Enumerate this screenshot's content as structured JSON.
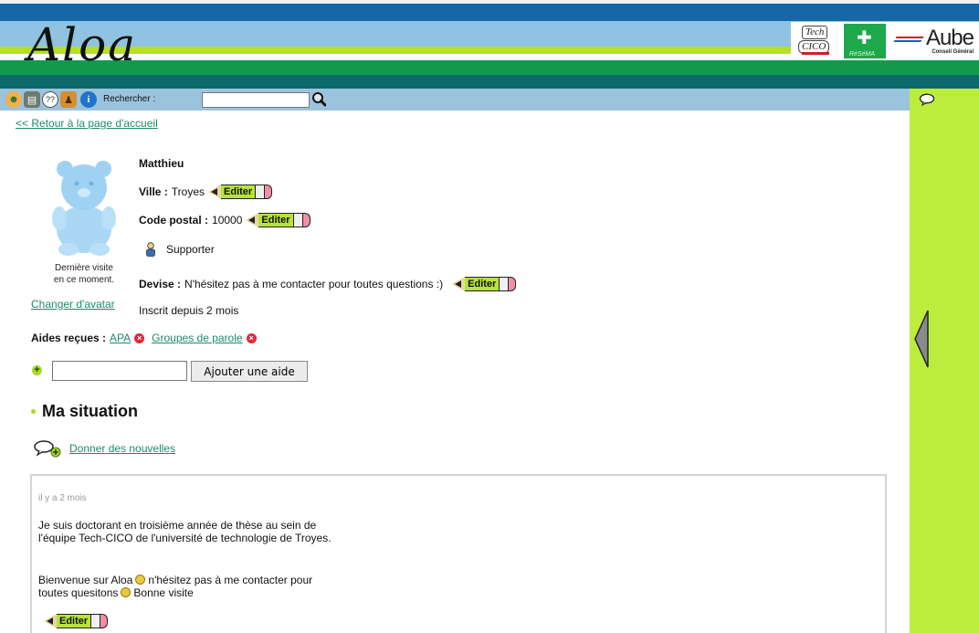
{
  "header": {
    "logo": "Aloa",
    "partners": {
      "techcico_top": "Tech",
      "techcico_bottom": "CICO",
      "resema": "RéSéMA",
      "aube_title": "Aube",
      "aube_subtitle": "Conseil Général"
    }
  },
  "toolbar": {
    "icons": [
      "users-icon",
      "book-icon",
      "chat-icon",
      "people-icon",
      "info-icon"
    ],
    "search_label": "Rechercher :",
    "search_value": ""
  },
  "nav": {
    "back_link": "<< Retour à la page d'accueil"
  },
  "profile": {
    "name": "Matthieu",
    "last_visit_line1": "Dernière visite",
    "last_visit_line2": "en ce moment.",
    "change_avatar": "Changer d'avatar",
    "ville_label": "Ville :",
    "ville_value": "Troyes",
    "cp_label": "Code postal :",
    "cp_value": "10000",
    "role": "Supporter",
    "devise_label": "Devise :",
    "devise_value": "N'hésitez pas à me contacter pour toutes questions :)",
    "inscrit": "Inscrit depuis 2 mois",
    "edit_label": "Editer"
  },
  "aides": {
    "label": "Aides reçues :",
    "items": [
      "APA",
      "Groupes de parole"
    ],
    "input_value": "",
    "add_button": "Ajouter une aide"
  },
  "situation": {
    "title": "Ma situation",
    "news_link": "Donner des nouvelles",
    "post": {
      "time": "il y a 2 mois",
      "paragraph1": "Je suis doctorant en troisième année de thèse au sein de l'équipe Tech-CICO de l'université de technologie de Troyes.",
      "paragraph2_a": "Bienvenue sur Aloa",
      "paragraph2_b": "n'hésitez pas à me contacter pour toutes quesitons",
      "paragraph2_c": "Bonne visite",
      "edit_label": "Editer"
    }
  },
  "colors": {
    "header_navy": "#1667a8",
    "header_sky": "#8fc3e1",
    "header_green": "#119a4e",
    "sidebar_lime": "#bded3c",
    "link_green": "#1b8a6b",
    "toolbar_blue": "#9cc3dd"
  }
}
